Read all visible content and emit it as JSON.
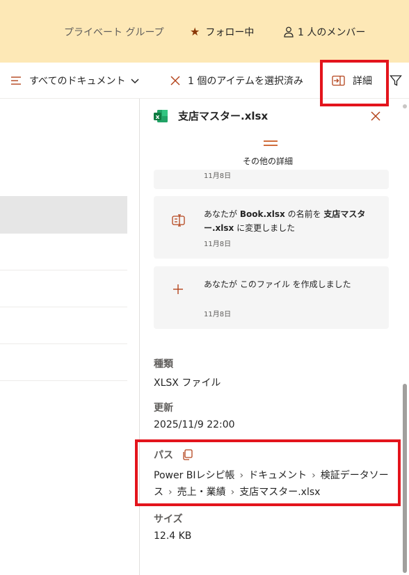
{
  "banner": {
    "privacy": "プライベート グループ",
    "follow": "フォロー中",
    "members": "1 人のメンバー"
  },
  "commandbar": {
    "all_documents": "すべてのドキュメント",
    "selected": "1 個のアイテムを選択済み",
    "details": "詳細"
  },
  "panel": {
    "file_name": "支店マスター.xlsx",
    "more_details": "その他の詳細",
    "activities": [
      {
        "date": "11月8日"
      },
      {
        "icon": "rename-icon",
        "text_prefix": "あなたが ",
        "old_name": "Book.xlsx",
        "text_mid": " の名前を ",
        "new_name": "支店マスター.xlsx",
        "text_suffix": " に変更しました",
        "date": "11月8日"
      },
      {
        "icon": "plus-icon",
        "text": "あなたが このファイル を作成しました",
        "date": "11月8日"
      }
    ],
    "type_label": "種類",
    "type_value": "XLSX ファイル",
    "modified_label": "更新",
    "modified_value": "2025/11/9 22:00",
    "path_label": "パス",
    "path": [
      "Power BIレシピ帳",
      "ドキュメント",
      "検証データソース",
      "売上・業績",
      "支店マスター.xlsx"
    ],
    "size_label": "サイズ",
    "size_value": "12.4 KB"
  },
  "colors": {
    "banner_bg": "#fde8b6",
    "accent": "#b4441c",
    "highlight": "#e3141c",
    "excel_green": "#107c41"
  }
}
